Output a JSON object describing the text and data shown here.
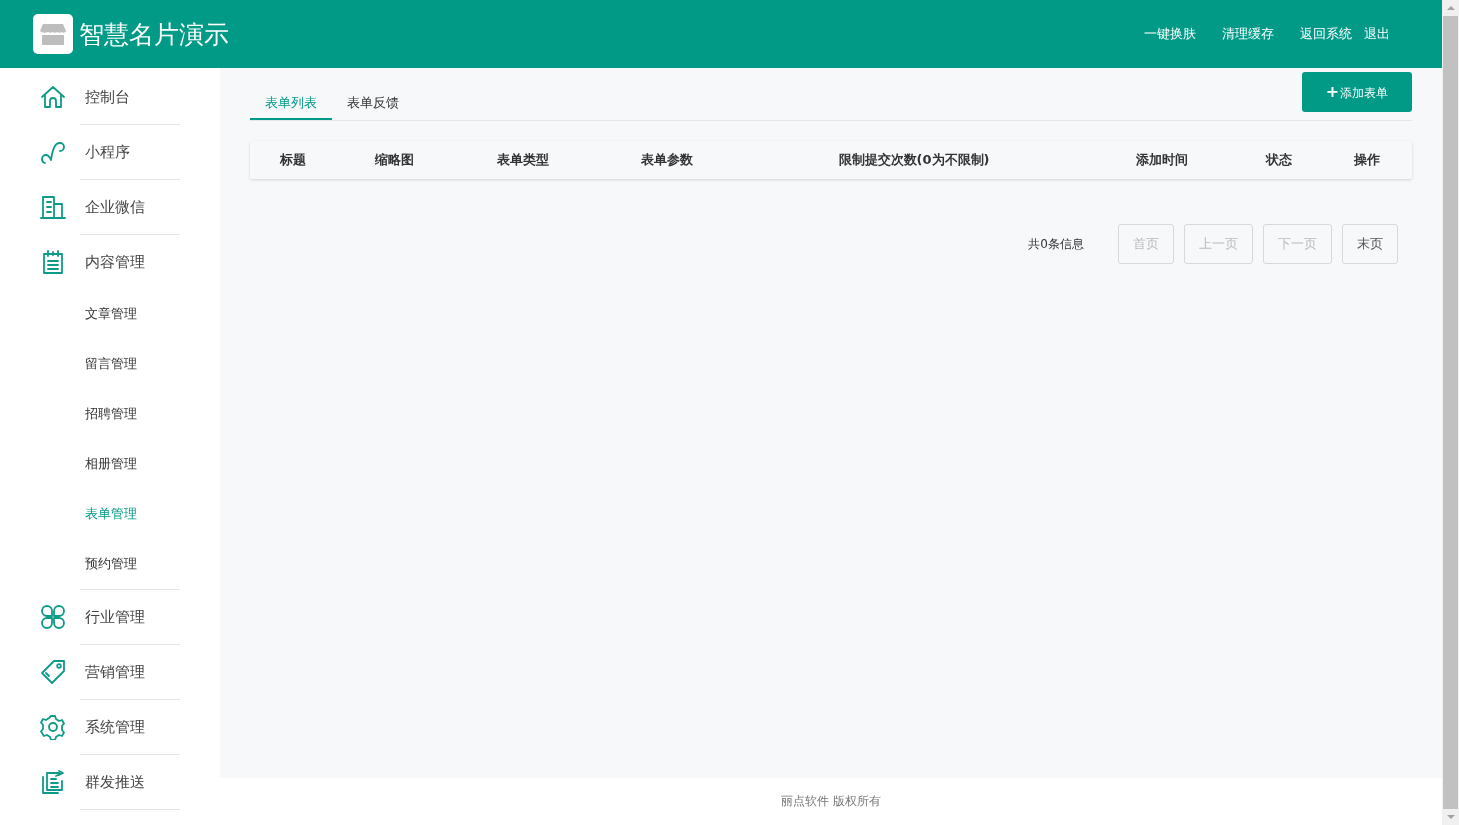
{
  "header": {
    "title": "智慧名片演示",
    "links": [
      "一键换肤",
      "清理缓存",
      "返回系统",
      "退出"
    ]
  },
  "sidebar": {
    "items": [
      {
        "label": "控制台",
        "selected": false
      },
      {
        "label": "小程序",
        "selected": false
      },
      {
        "label": "企业微信",
        "selected": false
      },
      {
        "label": "内容管理",
        "selected": false,
        "children": [
          {
            "label": "文章管理",
            "selected": false
          },
          {
            "label": "留言管理",
            "selected": false
          },
          {
            "label": "招聘管理",
            "selected": false
          },
          {
            "label": "相册管理",
            "selected": false
          },
          {
            "label": "表单管理",
            "selected": true
          },
          {
            "label": "预约管理",
            "selected": false
          }
        ]
      },
      {
        "label": "行业管理",
        "selected": false
      },
      {
        "label": "营销管理",
        "selected": false
      },
      {
        "label": "系统管理",
        "selected": false
      },
      {
        "label": "群发推送",
        "selected": false
      }
    ]
  },
  "tabs": [
    {
      "label": "表单列表",
      "selected": true
    },
    {
      "label": "表单反馈",
      "selected": false
    }
  ],
  "add_button": {
    "icon": "+",
    "label": "添加表单"
  },
  "table": {
    "columns": [
      "标题",
      "缩略图",
      "表单类型",
      "表单参数",
      "限制提交次数(0为不限制)",
      "添加时间",
      "状态",
      "操作"
    ]
  },
  "pagination": {
    "summary": "共0条信息",
    "buttons": [
      {
        "label": "首页",
        "disabled": true
      },
      {
        "label": "上一页",
        "disabled": true
      },
      {
        "label": "下一页",
        "disabled": true
      },
      {
        "label": "末页",
        "disabled": false
      }
    ]
  },
  "footer": {
    "text": "丽点软件 版权所有"
  }
}
